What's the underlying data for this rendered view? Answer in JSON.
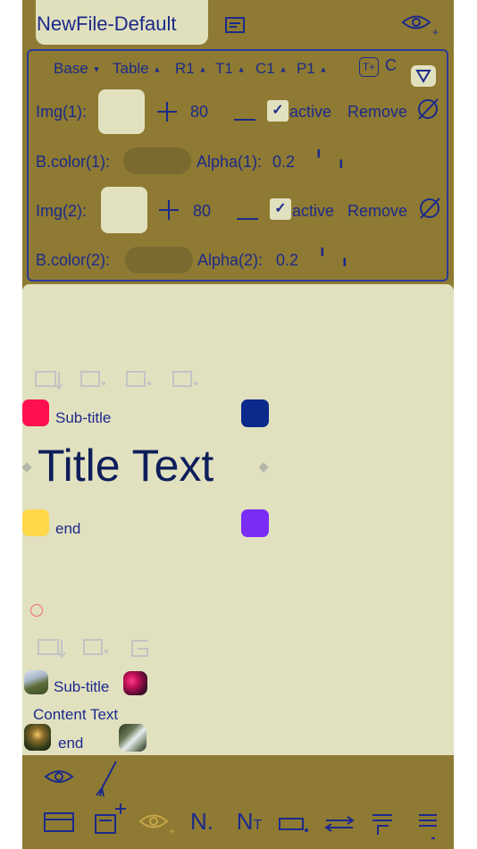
{
  "file": {
    "name": "NewFile-Default"
  },
  "panel": {
    "tabs": [
      "Base",
      "Table",
      "R1",
      "T1",
      "C1",
      "P1"
    ],
    "tab_extra": [
      "T+",
      "C"
    ],
    "rows": [
      {
        "img_label": "Img(1):",
        "value": "80",
        "active_label": "active",
        "remove_label": "Remove",
        "bcolor_label": "B.color(1):",
        "alpha_label": "Alpha(1):",
        "alpha_value": "0.2"
      },
      {
        "img_label": "Img(2):",
        "value": "80",
        "active_label": "active",
        "remove_label": "Remove",
        "bcolor_label": "B.color(2):",
        "alpha_label": "Alpha(2):",
        "alpha_value": "0.2"
      }
    ]
  },
  "canvas": {
    "sub_title": "Sub-title",
    "title": "Title Text",
    "end": "end",
    "sub_title2": "Sub-title",
    "content": "Content Text",
    "end2": "end"
  },
  "colors": {
    "app_bg": "#8e7a32",
    "canvas_bg": "#e1e1c0",
    "accent_text": "#1c2a8a",
    "square_red": "#ff1050",
    "square_navy": "#0a2a8c",
    "square_yellow": "#ffd84a",
    "square_purple": "#7a2cf5"
  }
}
